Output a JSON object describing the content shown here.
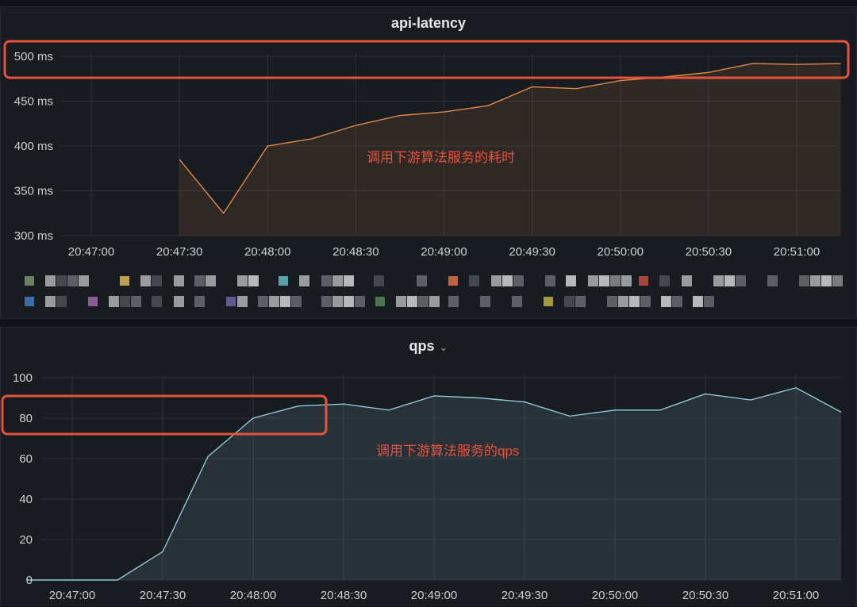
{
  "chart_data": [
    {
      "type": "area",
      "title": "api-latency",
      "xlabel": "",
      "ylabel": "",
      "x": [
        "20:47:30",
        "20:47:45",
        "20:48:00",
        "20:48:15",
        "20:48:30",
        "20:48:45",
        "20:49:00",
        "20:49:15",
        "20:49:30",
        "20:49:45",
        "20:50:00",
        "20:50:15",
        "20:50:30",
        "20:50:45",
        "20:51:00",
        "20:51:15"
      ],
      "series": [
        {
          "color": "#e0894b",
          "values": [
            385,
            325,
            400,
            408,
            423,
            434,
            438,
            445,
            466,
            464,
            473,
            477,
            482,
            492,
            491,
            492
          ]
        }
      ],
      "x_ticks": [
        "20:47:00",
        "20:47:30",
        "20:48:00",
        "20:48:30",
        "20:49:00",
        "20:49:30",
        "20:50:00",
        "20:50:30",
        "20:51:00"
      ],
      "y_ticks": [
        "300 ms",
        "350 ms",
        "400 ms",
        "450 ms",
        "500 ms"
      ],
      "ylim": [
        300,
        500
      ],
      "grid": true,
      "annotation": "调用下游算法服务的耗时"
    },
    {
      "type": "area",
      "title": "qps",
      "xlabel": "",
      "ylabel": "",
      "x": [
        "20:46:45",
        "20:47:00",
        "20:47:15",
        "20:47:30",
        "20:47:45",
        "20:48:00",
        "20:48:15",
        "20:48:30",
        "20:48:45",
        "20:49:00",
        "20:49:15",
        "20:49:30",
        "20:49:45",
        "20:50:00",
        "20:50:15",
        "20:50:30",
        "20:50:45",
        "20:51:00",
        "20:51:15"
      ],
      "series": [
        {
          "color": "#8fc9dc",
          "values": [
            0,
            0,
            0,
            14,
            61,
            80,
            86,
            87,
            84,
            91,
            90,
            88,
            81,
            84,
            84,
            92,
            89,
            95,
            83
          ]
        }
      ],
      "x_ticks": [
        "20:47:00",
        "20:47:30",
        "20:48:00",
        "20:48:30",
        "20:49:00",
        "20:49:30",
        "20:50:00",
        "20:50:30",
        "20:51:00"
      ],
      "y_ticks": [
        "0",
        "20",
        "40",
        "60",
        "80",
        "100"
      ],
      "ylim": [
        0,
        100
      ],
      "grid": true,
      "annotation": "调用下游算法服务的qps"
    }
  ],
  "colors": {
    "latency_line": "#e0894b",
    "qps_line": "#8fc9dc",
    "highlight_box": "#e4533c",
    "panel_bg": "#181b1f",
    "grid": "#2f3238"
  },
  "icons": {
    "title_menu": "chevron-down-icon"
  },
  "legend_colors": [
    "#6b7f62",
    "#b8a24a",
    "#5aa3a8",
    "#c0623c",
    "#a8463d",
    "#3d6ba8",
    "#8a5b98",
    "#5f5b92",
    "#4e7350",
    "#a79a3e"
  ]
}
